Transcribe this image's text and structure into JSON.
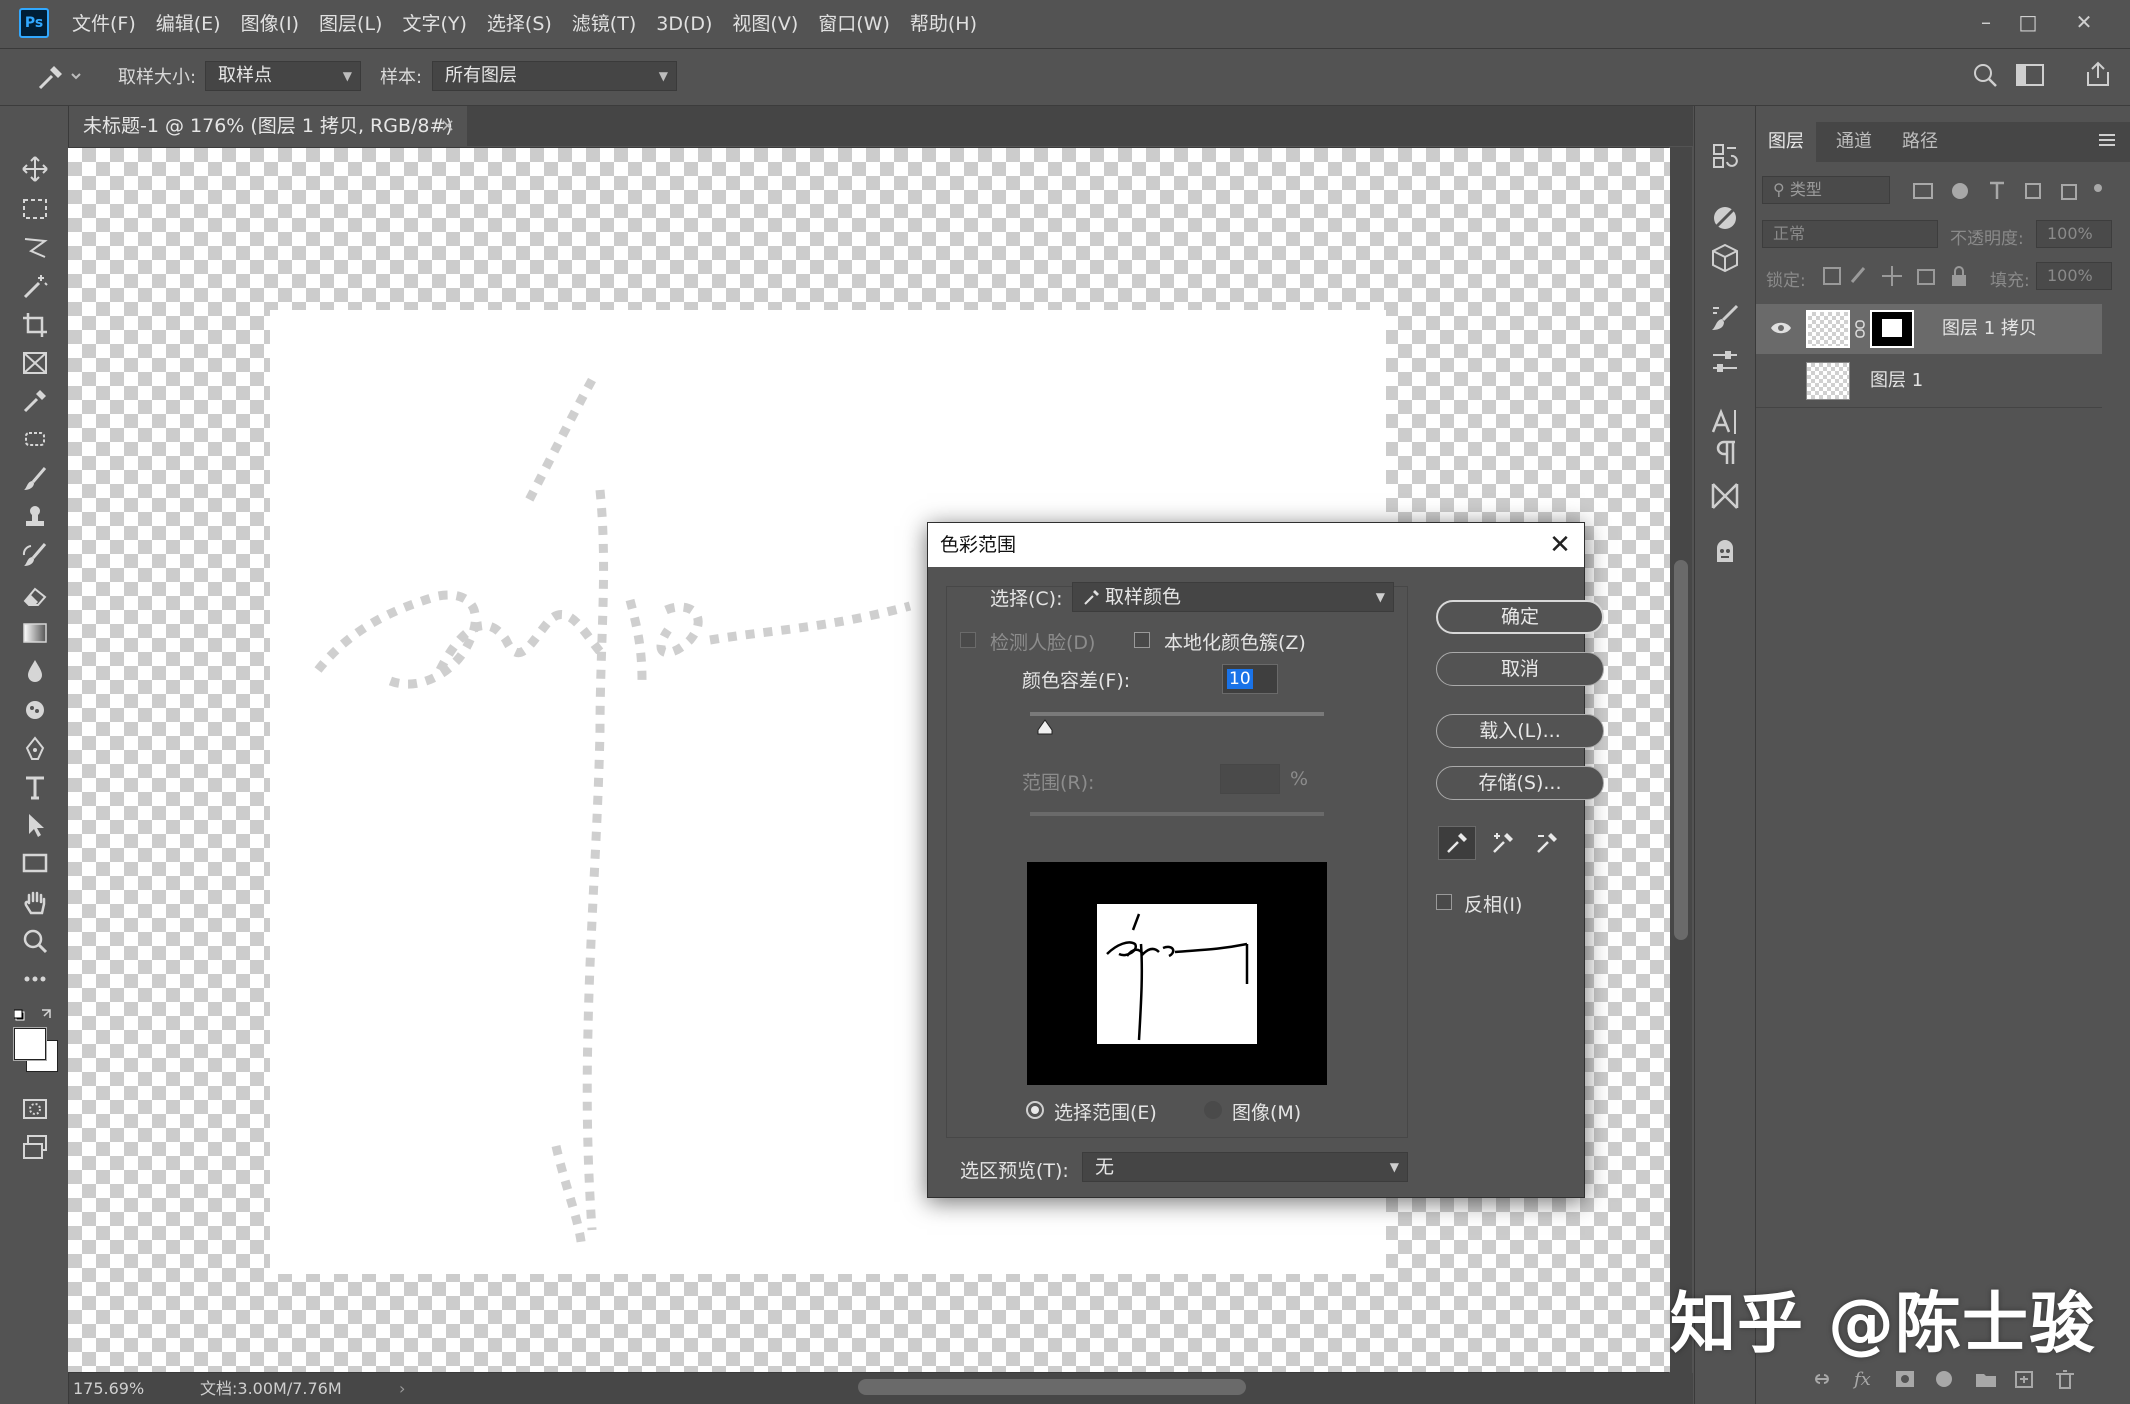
{
  "app": {
    "logo": "Ps"
  },
  "menu": [
    "文件(F)",
    "编辑(E)",
    "图像(I)",
    "图层(L)",
    "文字(Y)",
    "选择(S)",
    "滤镜(T)",
    "3D(D)",
    "视图(V)",
    "窗口(W)",
    "帮助(H)"
  ],
  "window_controls": {
    "minimize": "–",
    "restore": "□",
    "close": "✕"
  },
  "options": {
    "sample_size_label": "取样大小:",
    "sample_size_value": "取样点",
    "sample_label": "样本:",
    "sample_value": "所有图层"
  },
  "document": {
    "tab_title": "未标题-1 @ 176% (图层 1 拷贝, RGB/8#) *",
    "tab_close": "×",
    "zoom": "175.69%",
    "doc_info": "文档:3.00M/7.76M"
  },
  "layers_panel": {
    "tabs": [
      "图层",
      "通道",
      "路径"
    ],
    "filter_placeholder": "类型",
    "blend_mode": "正常",
    "opacity_label": "不透明度:",
    "opacity_value": "100%",
    "lock_label": "锁定:",
    "fill_label": "填充:",
    "fill_value": "100%",
    "layers": [
      {
        "name": "图层 1 拷贝",
        "visible": true,
        "selected": true
      },
      {
        "name": "图层 1",
        "visible": false,
        "selected": false
      }
    ]
  },
  "dialog": {
    "title": "色彩范围",
    "select_label": "选择(C):",
    "select_value": "取样颜色",
    "detect_faces": "检测人脸(D)",
    "localized_clusters": "本地化颜色簇(Z)",
    "fuzziness_label": "颜色容差(F):",
    "fuzziness_value": "10",
    "range_label": "范围(R):",
    "range_unit": "%",
    "radio_selection": "选择范围(E)",
    "radio_image": "图像(M)",
    "selection_preview_label": "选区预览(T):",
    "selection_preview_value": "无",
    "buttons": {
      "ok": "确定",
      "cancel": "取消",
      "load": "载入(L)...",
      "save": "存储(S)..."
    },
    "invert": "反相(I)"
  },
  "watermark": "知乎 @陈士骏",
  "colors": {
    "ui_bg": "#535353",
    "dark_bg": "#3a3a3a",
    "highlight": "#1a73e8",
    "ps_blue": "#31a8ff"
  }
}
